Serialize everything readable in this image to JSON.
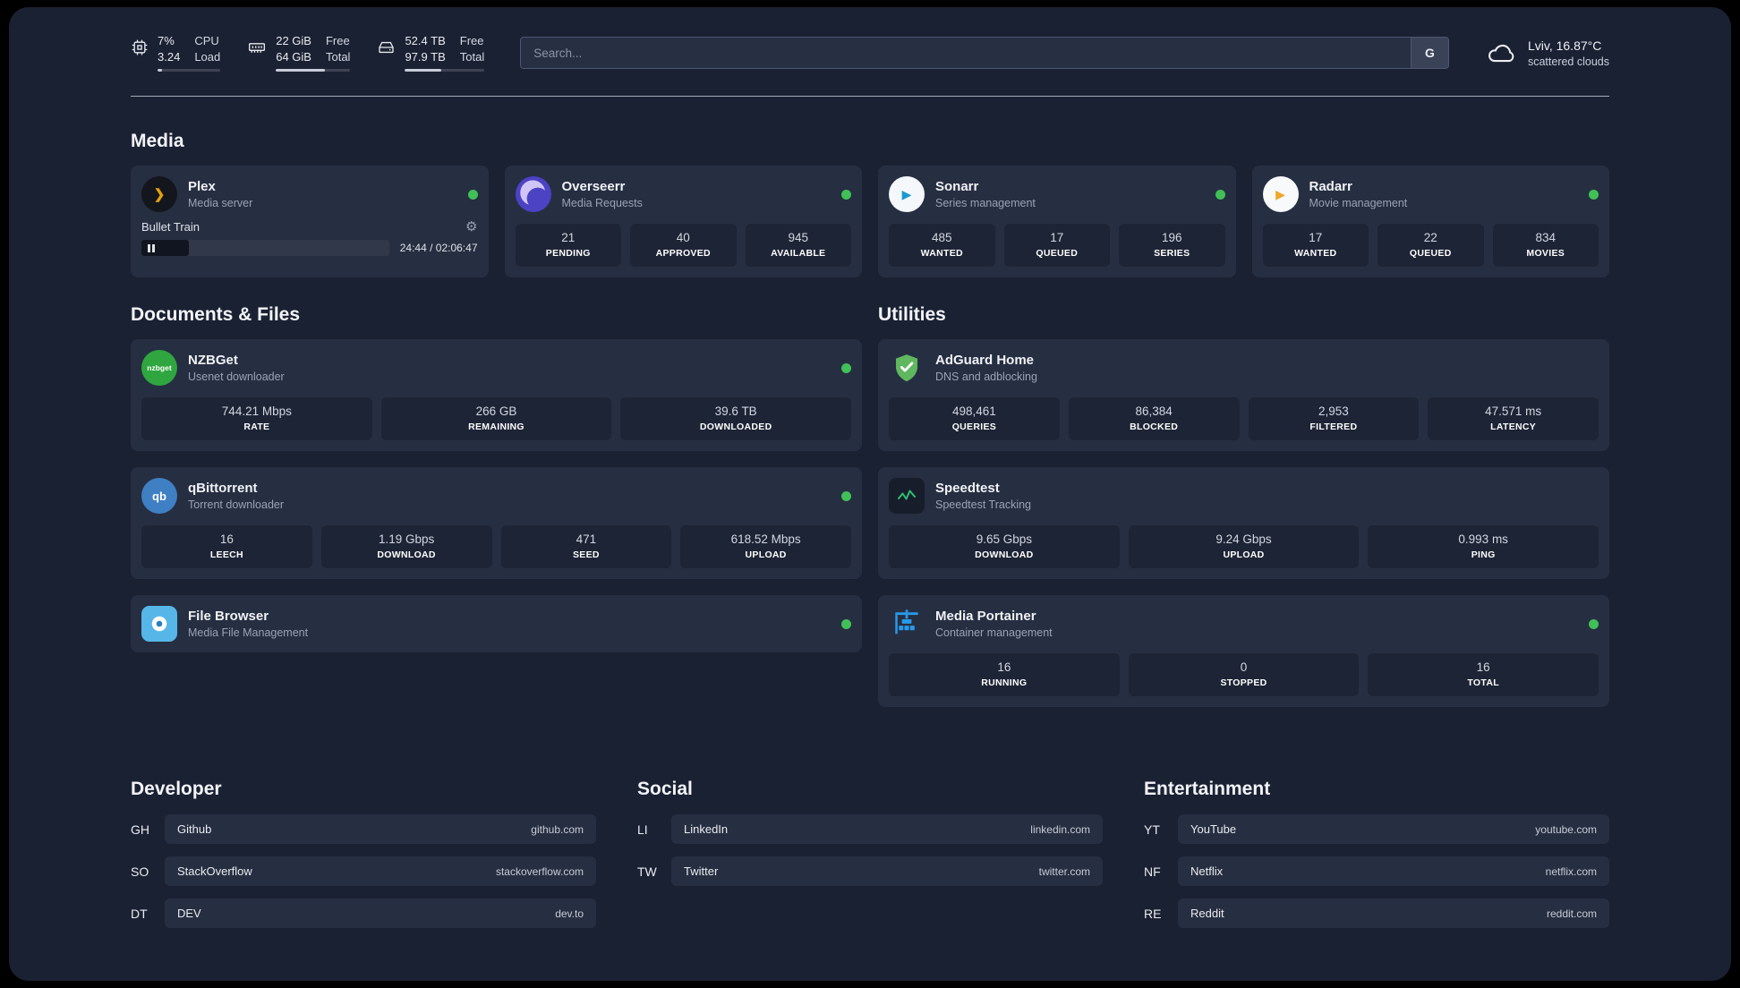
{
  "window": {
    "background": "#1a2133",
    "card_color": "#262e41",
    "tile_color": "#1d2435",
    "status_online_color": "#40c057"
  },
  "topbar": {
    "cpu": {
      "value": "7%",
      "detail": "3.24",
      "label_top": "CPU",
      "label_bottom": "Load",
      "progress_pct": 7
    },
    "memory": {
      "value": "22 GiB",
      "detail": "64 GiB",
      "label_top": "Free",
      "label_bottom": "Total",
      "progress_pct": 66
    },
    "storage": {
      "value": "52.4 TB",
      "detail": "97.9 TB",
      "label_top": "Free",
      "label_bottom": "Total",
      "progress_pct": 46
    },
    "search": {
      "placeholder": "Search...",
      "engine_label": "G"
    },
    "weather": {
      "location": "Lviv, 16.87°C",
      "condition": "scattered clouds"
    }
  },
  "sections": {
    "media": "Media",
    "documents": "Documents & Files",
    "utilities": "Utilities"
  },
  "apps": {
    "plex": {
      "name": "Plex",
      "desc": "Media server",
      "status": "online",
      "icon_glyph": "❯",
      "player": {
        "title": "Bullet Train",
        "time": "24:44 / 02:06:47",
        "progress_pct": 19
      }
    },
    "overseerr": {
      "name": "Overseerr",
      "desc": "Media Requests",
      "status": "online",
      "stats": [
        {
          "value": "21",
          "label": "PENDING"
        },
        {
          "value": "40",
          "label": "APPROVED"
        },
        {
          "value": "945",
          "label": "AVAILABLE"
        }
      ]
    },
    "sonarr": {
      "name": "Sonarr",
      "desc": "Series management",
      "status": "online",
      "icon_glyph": "▶",
      "stats": [
        {
          "value": "485",
          "label": "WANTED"
        },
        {
          "value": "17",
          "label": "QUEUED"
        },
        {
          "value": "196",
          "label": "SERIES"
        }
      ]
    },
    "radarr": {
      "name": "Radarr",
      "desc": "Movie management",
      "status": "online",
      "icon_glyph": "▶",
      "stats": [
        {
          "value": "17",
          "label": "WANTED"
        },
        {
          "value": "22",
          "label": "QUEUED"
        },
        {
          "value": "834",
          "label": "MOVIES"
        }
      ]
    },
    "nzbget": {
      "name": "NZBGet",
      "desc": "Usenet downloader",
      "status": "online",
      "icon_glyph": "nzbget",
      "stats": [
        {
          "value": "744.21 Mbps",
          "label": "RATE"
        },
        {
          "value": "266 GB",
          "label": "REMAINING"
        },
        {
          "value": "39.6 TB",
          "label": "DOWNLOADED"
        }
      ]
    },
    "qbittorrent": {
      "name": "qBittorrent",
      "desc": "Torrent downloader",
      "status": "online",
      "icon_glyph": "qb",
      "stats": [
        {
          "value": "16",
          "label": "LEECH"
        },
        {
          "value": "1.19 Gbps",
          "label": "DOWNLOAD"
        },
        {
          "value": "471",
          "label": "SEED"
        },
        {
          "value": "618.52 Mbps",
          "label": "UPLOAD"
        }
      ]
    },
    "filebrowser": {
      "name": "File Browser",
      "desc": "Media File Management",
      "status": "online"
    },
    "adguard": {
      "name": "AdGuard Home",
      "desc": "DNS and adblocking",
      "stats": [
        {
          "value": "498,461",
          "label": "QUERIES"
        },
        {
          "value": "86,384",
          "label": "BLOCKED"
        },
        {
          "value": "2,953",
          "label": "FILTERED"
        },
        {
          "value": "47.571 ms",
          "label": "LATENCY"
        }
      ]
    },
    "speedtest": {
      "name": "Speedtest",
      "desc": "Speedtest Tracking",
      "stats": [
        {
          "value": "9.65 Gbps",
          "label": "DOWNLOAD"
        },
        {
          "value": "9.24 Gbps",
          "label": "UPLOAD"
        },
        {
          "value": "0.993 ms",
          "label": "PING"
        }
      ]
    },
    "portainer": {
      "name": "Media Portainer",
      "desc": "Container management",
      "status": "online",
      "stats": [
        {
          "value": "16",
          "label": "RUNNING"
        },
        {
          "value": "0",
          "label": "STOPPED"
        },
        {
          "value": "16",
          "label": "TOTAL"
        }
      ]
    }
  },
  "bookmarks": {
    "developer": {
      "title": "Developer",
      "items": [
        {
          "abbr": "GH",
          "name": "Github",
          "url": "github.com"
        },
        {
          "abbr": "SO",
          "name": "StackOverflow",
          "url": "stackoverflow.com"
        },
        {
          "abbr": "DT",
          "name": "DEV",
          "url": "dev.to"
        }
      ]
    },
    "social": {
      "title": "Social",
      "items": [
        {
          "abbr": "LI",
          "name": "LinkedIn",
          "url": "linkedin.com"
        },
        {
          "abbr": "TW",
          "name": "Twitter",
          "url": "twitter.com"
        }
      ]
    },
    "entertainment": {
      "title": "Entertainment",
      "items": [
        {
          "abbr": "YT",
          "name": "YouTube",
          "url": "youtube.com"
        },
        {
          "abbr": "NF",
          "name": "Netflix",
          "url": "netflix.com"
        },
        {
          "abbr": "RE",
          "name": "Reddit",
          "url": "reddit.com"
        }
      ]
    }
  }
}
